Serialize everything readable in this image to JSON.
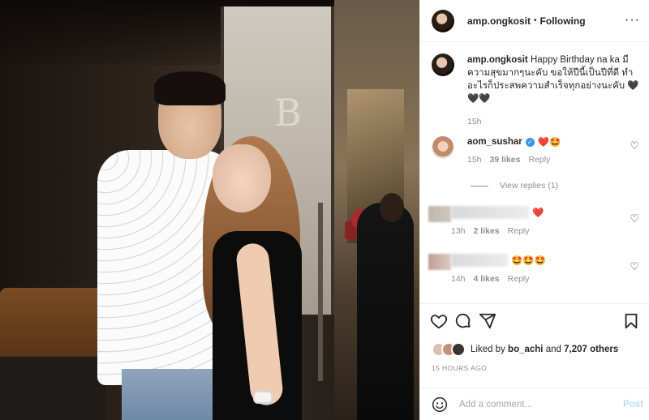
{
  "header": {
    "username": "amp.ongkosit",
    "separator": "•",
    "follow_status": "Following",
    "more": "···"
  },
  "caption": {
    "username": "amp.ongkosit",
    "text": "Happy Birthday na ka มีความสุขมากๆนะคับ ขอให้ปีนี้เป็นปีที่ดี ทำอะไรก็ประสพความสำเร็จทุกอย่างนะคับ 🖤🖤🖤",
    "time": "15h"
  },
  "comments": [
    {
      "username": "aom_sushar",
      "verified": true,
      "text": "❤️🤩",
      "time": "15h",
      "likes": "39 likes",
      "reply": "Reply",
      "view_replies": "View replies (1)"
    },
    {
      "username": "",
      "text": "❤️",
      "time": "13h",
      "likes": "2 likes",
      "reply": "Reply"
    },
    {
      "username": "",
      "text": "🤩🤩🤩",
      "time": "14h",
      "likes": "4 likes",
      "reply": "Reply"
    }
  ],
  "actions": {
    "icons": [
      "heart-outline-icon",
      "comment-icon",
      "share-icon",
      "bookmark-icon"
    ]
  },
  "liked_by": {
    "prefix": "Liked by",
    "user": "bo_achi",
    "conj": "and",
    "others": "7,207 others"
  },
  "posted_ago": "15 HOURS AGO",
  "add_comment": {
    "placeholder": "Add a comment...",
    "post_label": "Post"
  },
  "colors": {
    "accent_blue": "#3897f0",
    "post_disabled": "#b2dffc",
    "heart_red": "#e0245e",
    "muted_text": "#8e8e8e"
  }
}
